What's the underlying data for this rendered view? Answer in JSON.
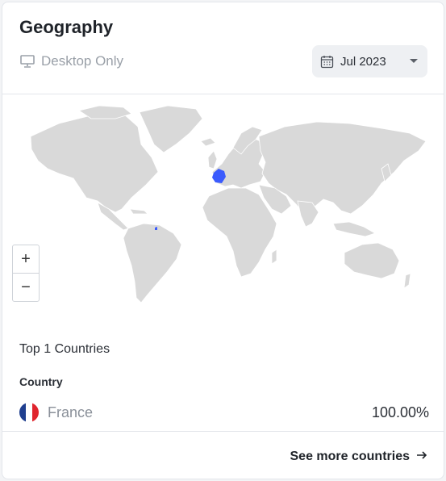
{
  "card": {
    "title": "Geography",
    "device_filter": {
      "label": "Desktop Only",
      "icon": "desktop-icon"
    },
    "date_select": {
      "value": "Jul 2023",
      "icon": "calendar-icon",
      "chevron": "chevron-down-icon"
    }
  },
  "map": {
    "land_color": "#d9d9d9",
    "highlight_color": "#3b5bfd",
    "zoom_in_label": "+",
    "zoom_out_label": "−"
  },
  "countries": {
    "heading": "Top 1 Countries",
    "column_label": "Country",
    "rows": [
      {
        "name": "France",
        "percent": "100.00%",
        "flag_colors": [
          "#1f3f8f",
          "#ffffff",
          "#e0252e"
        ]
      }
    ]
  },
  "footer": {
    "see_more_label": "See more countries",
    "icon": "arrow-right-icon"
  }
}
